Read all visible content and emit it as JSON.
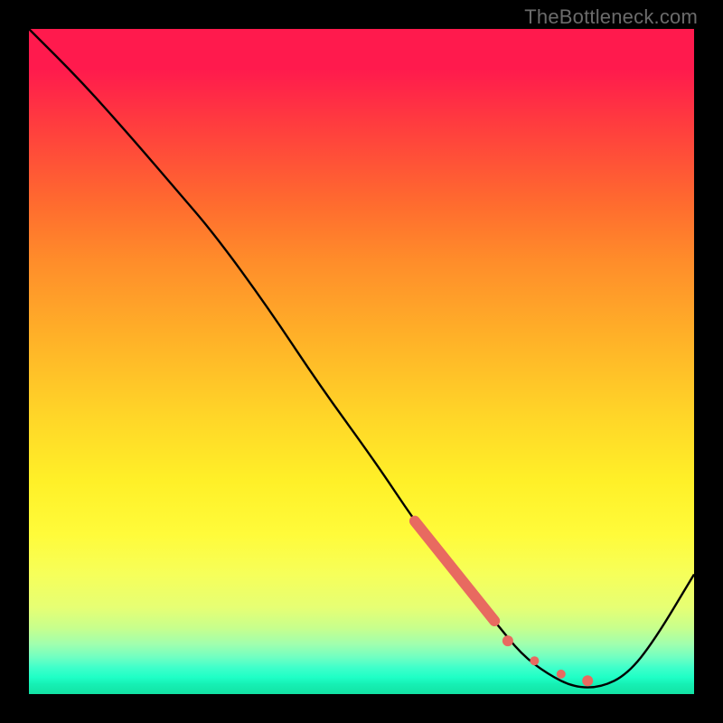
{
  "watermark": "TheBottleneck.com",
  "chart_data": {
    "type": "line",
    "title": "",
    "xlabel": "",
    "ylabel": "",
    "xlim": [
      0,
      100
    ],
    "ylim": [
      0,
      100
    ],
    "background_gradient": {
      "direction": "vertical",
      "stops": [
        {
          "pos": 0,
          "color": "#ff1a4d"
        },
        {
          "pos": 50,
          "color": "#ffd528"
        },
        {
          "pos": 80,
          "color": "#fffb3a"
        },
        {
          "pos": 100,
          "color": "#13e2a4"
        }
      ],
      "meaning": "top=worst, bottom=best"
    },
    "series": [
      {
        "name": "bottleneck-curve",
        "color": "#000000",
        "x": [
          0,
          8,
          16,
          22,
          28,
          36,
          44,
          52,
          58,
          64,
          70,
          74,
          78,
          82,
          86,
          90,
          94,
          100
        ],
        "y": [
          100,
          92,
          83,
          76,
          69,
          58,
          46,
          35,
          26,
          18,
          11,
          6,
          3,
          1,
          1,
          3,
          8,
          18
        ]
      }
    ],
    "highlight_segment": {
      "name": "highlighted-range",
      "color": "#e86a60",
      "style": "thick-solid",
      "x": [
        58,
        70
      ],
      "y": [
        26,
        11
      ]
    },
    "dotted_segment": {
      "name": "optimal-zone",
      "color": "#e86a60",
      "style": "dotted",
      "points_x": [
        72,
        76,
        80,
        84
      ],
      "points_y": [
        8,
        5,
        3,
        2
      ]
    }
  }
}
